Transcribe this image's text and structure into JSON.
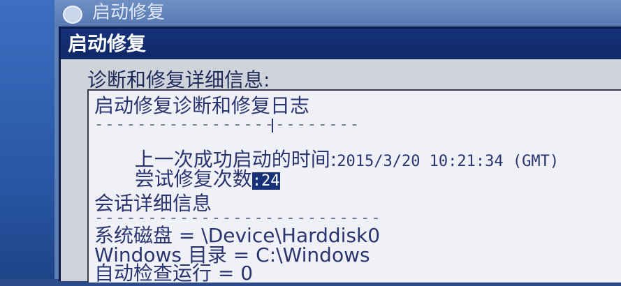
{
  "outer_window": {
    "title": "启动修复",
    "icon": "shield-icon"
  },
  "dialog": {
    "title": "启动修复",
    "section_label": "诊断和修复详细信息:",
    "log": {
      "heading": "启动修复诊断和修复日志",
      "separator1": "-------------------------",
      "last_boot_label": "上一次成功启动的时间:",
      "last_boot_value": "2015/3/20 10:21:34 (GMT)",
      "repair_attempts_label": "尝试修复次数",
      "repair_attempts_value": ":24",
      "session_heading": "会话详细信息",
      "separator2": "---------------------------",
      "system_disk": "系统磁盘 = \\Device\\Harddisk0",
      "windows_dir": "Windows 目录 = C:\\Windows",
      "autocheck": "自动检查运行 = 0"
    }
  }
}
